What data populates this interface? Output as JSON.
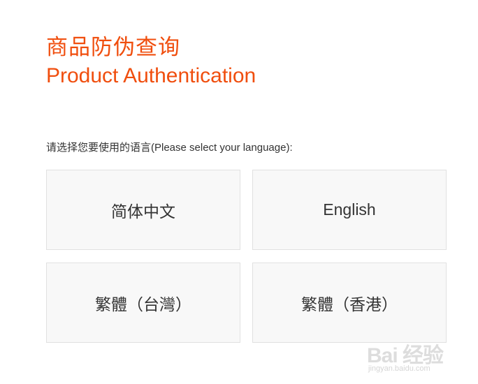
{
  "header": {
    "title_cn": "商品防伪查询",
    "title_en": "Product Authentication"
  },
  "prompt": "请选择您要使用的语言(Please select your language):",
  "languages": [
    {
      "label": "简体中文"
    },
    {
      "label": "English"
    },
    {
      "label": "繁體（台灣）"
    },
    {
      "label": "繁體（香港）"
    }
  ],
  "watermark": {
    "logo": "Bai 经验",
    "url": "jingyan.baidu.com"
  },
  "colors": {
    "accent": "#f04e0e",
    "button_bg": "#f8f8f8",
    "button_border": "#e1e1e1",
    "text": "#333333"
  }
}
